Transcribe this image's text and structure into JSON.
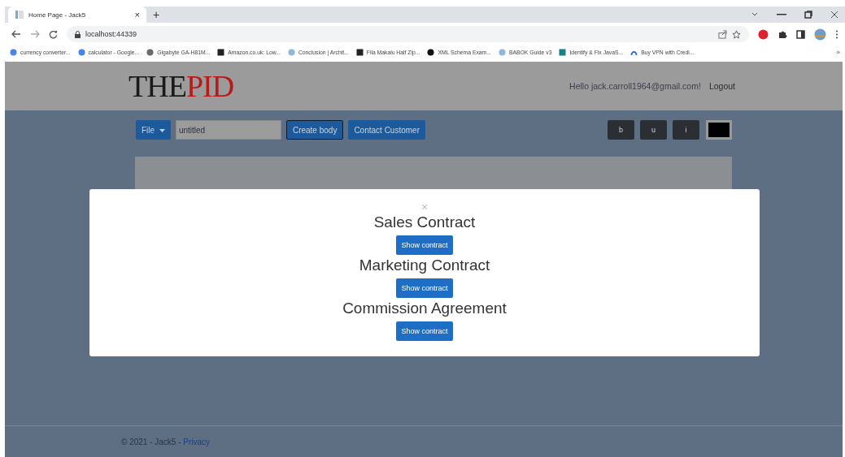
{
  "browser": {
    "tab": {
      "title": "Home Page - Jack5",
      "close": "×"
    },
    "new_tab": "+",
    "url": "localhost:44339",
    "bookmarks": [
      {
        "kind": "google",
        "label": "currency converter..."
      },
      {
        "kind": "google",
        "label": "calculator - Google..."
      },
      {
        "kind": "chip",
        "label": "Gigabyte GA-H81M..."
      },
      {
        "kind": "amazon",
        "label": "Amazon.co.uk: Low..."
      },
      {
        "kind": "flower",
        "label": "Conclusion | Archit..."
      },
      {
        "kind": "square",
        "label": "Fila Makalu Half Zip..."
      },
      {
        "kind": "github",
        "label": "XML Schema Exam..."
      },
      {
        "kind": "flower",
        "label": "BABOK Guide v3"
      },
      {
        "kind": "teal",
        "label": "Identify & Fix JavaS..."
      },
      {
        "kind": "vpn",
        "label": "Buy VPN with Credi..."
      }
    ],
    "more_bookmarks": "»"
  },
  "header": {
    "logo": {
      "first": "THE",
      "second": "PID"
    },
    "greeting": "Hello jack.carroll1964@gmail.com!",
    "logout": "Logout"
  },
  "toolbar": {
    "file_menu": "File",
    "title_field": "untitled",
    "create_body": "Create body",
    "contact_customer": "Contact Customer",
    "format_buttons": [
      "b",
      "u",
      "i"
    ]
  },
  "modal": {
    "close": "×",
    "contracts": [
      {
        "title": "Sales Contract",
        "button": "Show contract"
      },
      {
        "title": "Marketing Contract",
        "button": "Show contract"
      },
      {
        "title": "Commission Agreement",
        "button": "Show contract"
      }
    ]
  },
  "footer": {
    "copyright": "© 2021 - Jack5 - ",
    "privacy": "Privacy"
  }
}
